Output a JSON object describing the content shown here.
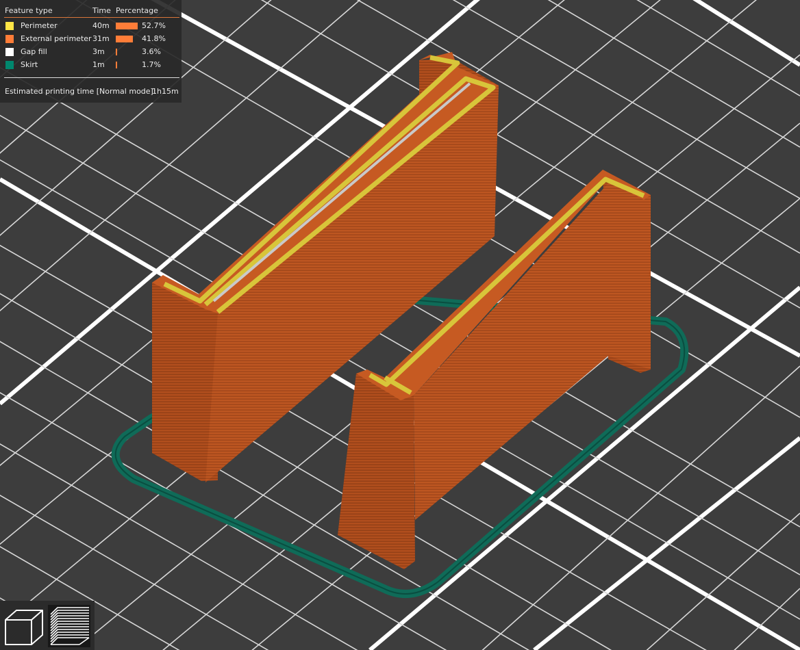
{
  "legend": {
    "header": {
      "feature_type": "Feature type",
      "time": "Time",
      "percentage": "Percentage"
    },
    "items": [
      {
        "name": "Perimeter",
        "time": "40m",
        "percentage": "52.7%",
        "fraction": 0.527,
        "color": "#ffe646"
      },
      {
        "name": "External perimeter",
        "time": "31m",
        "percentage": "41.8%",
        "fraction": 0.418,
        "color": "#ff7d38"
      },
      {
        "name": "Gap fill",
        "time": "3m",
        "percentage": "3.6%",
        "fraction": 0.036,
        "color": "#ffffff"
      },
      {
        "name": "Skirt",
        "time": "1m",
        "percentage": "1.7%",
        "fraction": 0.017,
        "color": "#00876e"
      }
    ],
    "estimated_label": "Estimated printing time [Normal mode]:",
    "estimated_value": "1h15m"
  },
  "toolbar": {
    "buttons": [
      {
        "name": "3d-view-button",
        "icon": "cube-icon",
        "active": false
      },
      {
        "name": "layers-view-button",
        "icon": "layers-icon",
        "active": true
      }
    ]
  },
  "colors": {
    "background": "#3d3d3d",
    "grid": "#ffffff",
    "wall_side": "#b8521f",
    "wall_top_external": "#c65a22",
    "wall_top_perimeter": "#d8c53a",
    "gap_fill": "#c9c9c9",
    "skirt": "#0f6b58",
    "bar_accent": "#ff7d38"
  }
}
